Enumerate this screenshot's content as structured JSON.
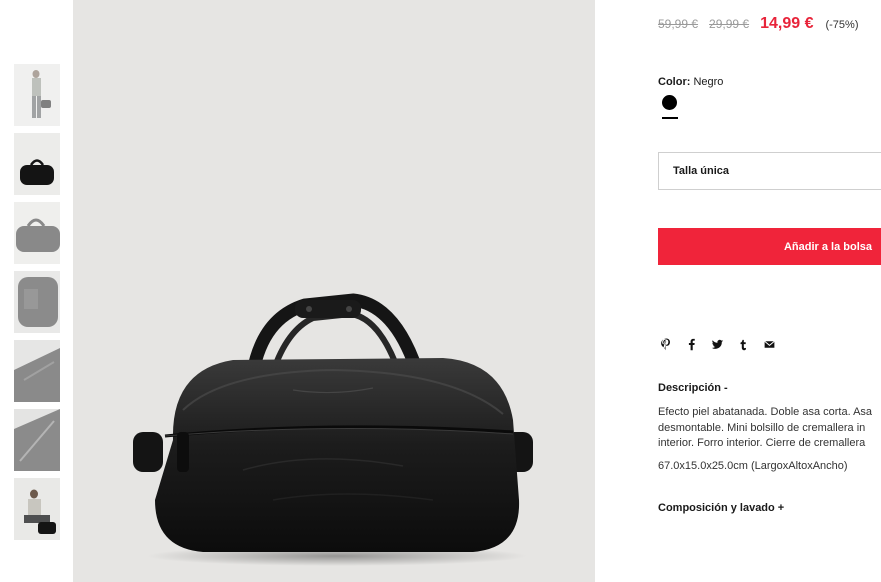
{
  "price": {
    "old_prices": [
      "59,99 €",
      "29,99 €"
    ],
    "current": "14,99 €",
    "discount": "(-75%)",
    "current_color": "#e8243a"
  },
  "color": {
    "label": "Color:",
    "value": "Negro",
    "swatch_color": "#000000"
  },
  "size": {
    "selected": "Talla única"
  },
  "cart": {
    "add_label": "Añadir a la bolsa",
    "button_color": "#f0243a"
  },
  "share": {
    "icons": [
      "pinterest-icon",
      "facebook-icon",
      "twitter-icon",
      "tumblr-icon",
      "email-icon"
    ]
  },
  "description": {
    "title": "Descripción -",
    "text": "Efecto piel abatanada. Doble asa corta. Asa desmontable. Mini bolsillo de cremallera in interior. Forro interior. Cierre de cremallera",
    "dimensions": "67.0x15.0x25.0cm (LargoxAltoxAncho)"
  },
  "composition": {
    "title": "Composición y lavado +"
  },
  "gallery": {
    "thumbnails": [
      "model-standing-with-bag",
      "bag-front",
      "bag-angle",
      "bag-detail-side",
      "bag-detail-top",
      "bag-detail-zipper",
      "model-sitting-with-bag"
    ]
  }
}
